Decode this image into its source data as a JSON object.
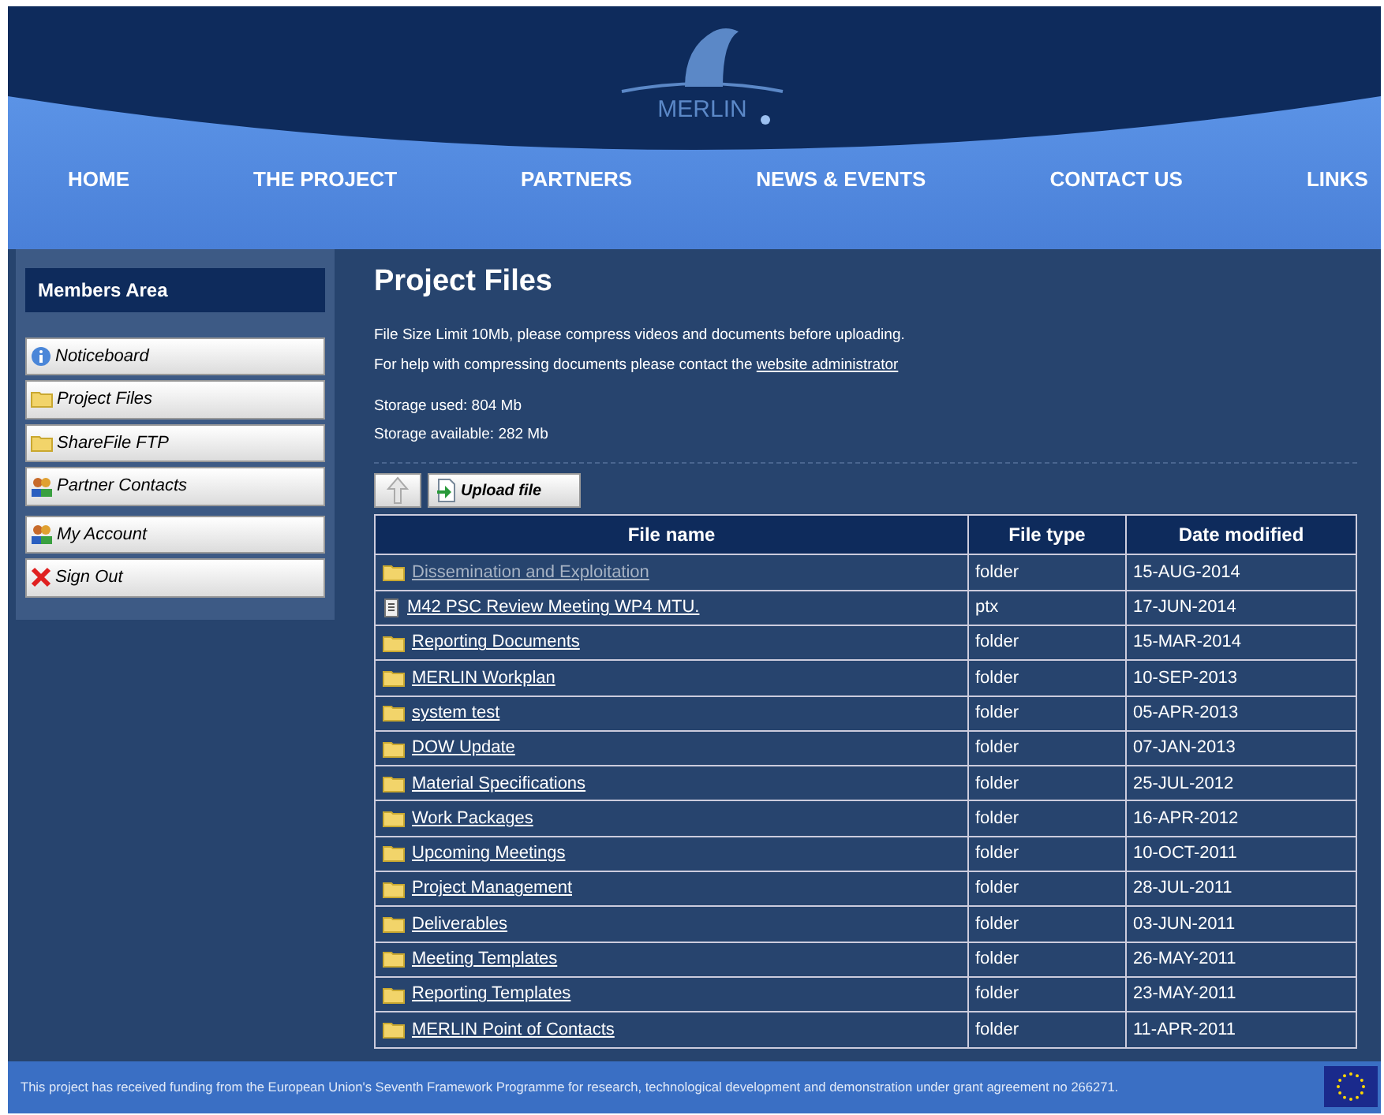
{
  "logo": {
    "text": "MERLIN"
  },
  "nav": [
    "HOME",
    "THE PROJECT",
    "PARTNERS",
    "NEWS & EVENTS",
    "CONTACT US",
    "LINKS"
  ],
  "sidebar": {
    "title": "Members Area",
    "groups": [
      [
        {
          "label": "Noticeboard",
          "kind": "info"
        },
        {
          "label": "Project Files",
          "kind": "folder"
        },
        {
          "label": "ShareFile FTP",
          "kind": "folder"
        },
        {
          "label": "Partner Contacts",
          "kind": "people"
        }
      ],
      [
        {
          "label": "My Account",
          "kind": "people"
        },
        {
          "label": "Sign Out",
          "kind": "signout"
        }
      ]
    ]
  },
  "main": {
    "title": "Project Files",
    "notes": [
      "File Size Limit 10Mb, please compress videos and documents before uploading.",
      "For help with compressing documents please contact the "
    ],
    "admin_link": "website administrator",
    "storage": [
      "Storage used: 804 Mb",
      "Storage available: 282 Mb"
    ],
    "upload_button": "Upload file",
    "table": {
      "columns": [
        "File name",
        "File type",
        "Date modified"
      ],
      "rows": [
        {
          "name": "Dissemination and Exploitation",
          "kind": "folder",
          "visited": true,
          "type": "folder",
          "date": "15-AUG-2014"
        },
        {
          "name": "M42 PSC Review Meeting WP4 MTU.",
          "kind": "file",
          "visited": false,
          "type": "ptx",
          "date": "17-JUN-2014"
        },
        {
          "name": "Reporting Documents",
          "kind": "folder",
          "visited": false,
          "type": "folder",
          "date": "15-MAR-2014"
        },
        {
          "name": "MERLIN Workplan",
          "kind": "folder",
          "visited": false,
          "type": "folder",
          "date": "10-SEP-2013"
        },
        {
          "name": "system test",
          "kind": "folder",
          "visited": false,
          "type": "folder",
          "date": "05-APR-2013"
        },
        {
          "name": "DOW Update",
          "kind": "folder",
          "visited": false,
          "type": "folder",
          "date": "07-JAN-2013"
        },
        {
          "name": "Material Specifications",
          "kind": "folder",
          "visited": false,
          "type": "folder",
          "date": "25-JUL-2012"
        },
        {
          "name": "Work Packages",
          "kind": "folder",
          "visited": false,
          "type": "folder",
          "date": "16-APR-2012"
        },
        {
          "name": "Upcoming Meetings",
          "kind": "folder",
          "visited": false,
          "type": "folder",
          "date": "10-OCT-2011"
        },
        {
          "name": "Project Management",
          "kind": "folder",
          "visited": false,
          "type": "folder",
          "date": "28-JUL-2011"
        },
        {
          "name": "Deliverables",
          "kind": "folder",
          "visited": false,
          "type": "folder",
          "date": "03-JUN-2011"
        },
        {
          "name": "Meeting Templates",
          "kind": "folder",
          "visited": false,
          "type": "folder",
          "date": "26-MAY-2011"
        },
        {
          "name": "Reporting Templates",
          "kind": "folder",
          "visited": false,
          "type": "folder",
          "date": "23-MAY-2011"
        },
        {
          "name": "MERLIN Point of Contacts",
          "kind": "folder",
          "visited": false,
          "type": "folder",
          "date": "11-APR-2011"
        }
      ]
    }
  },
  "footer": "This project has received funding from the European Union's Seventh Framework Programme for research, technological development and demonstration under grant agreement no 266271."
}
